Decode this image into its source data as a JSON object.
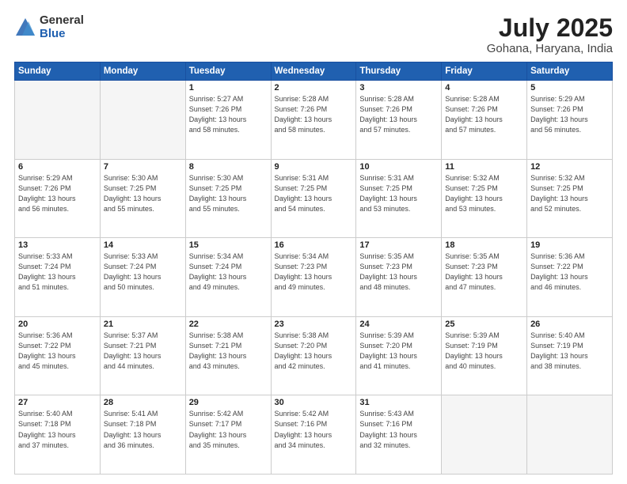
{
  "header": {
    "logo_general": "General",
    "logo_blue": "Blue",
    "month_year": "July 2025",
    "location": "Gohana, Haryana, India"
  },
  "weekdays": [
    "Sunday",
    "Monday",
    "Tuesday",
    "Wednesday",
    "Thursday",
    "Friday",
    "Saturday"
  ],
  "weeks": [
    [
      {
        "day": "",
        "info": ""
      },
      {
        "day": "",
        "info": ""
      },
      {
        "day": "1",
        "info": "Sunrise: 5:27 AM\nSunset: 7:26 PM\nDaylight: 13 hours\nand 58 minutes."
      },
      {
        "day": "2",
        "info": "Sunrise: 5:28 AM\nSunset: 7:26 PM\nDaylight: 13 hours\nand 58 minutes."
      },
      {
        "day": "3",
        "info": "Sunrise: 5:28 AM\nSunset: 7:26 PM\nDaylight: 13 hours\nand 57 minutes."
      },
      {
        "day": "4",
        "info": "Sunrise: 5:28 AM\nSunset: 7:26 PM\nDaylight: 13 hours\nand 57 minutes."
      },
      {
        "day": "5",
        "info": "Sunrise: 5:29 AM\nSunset: 7:26 PM\nDaylight: 13 hours\nand 56 minutes."
      }
    ],
    [
      {
        "day": "6",
        "info": "Sunrise: 5:29 AM\nSunset: 7:26 PM\nDaylight: 13 hours\nand 56 minutes."
      },
      {
        "day": "7",
        "info": "Sunrise: 5:30 AM\nSunset: 7:25 PM\nDaylight: 13 hours\nand 55 minutes."
      },
      {
        "day": "8",
        "info": "Sunrise: 5:30 AM\nSunset: 7:25 PM\nDaylight: 13 hours\nand 55 minutes."
      },
      {
        "day": "9",
        "info": "Sunrise: 5:31 AM\nSunset: 7:25 PM\nDaylight: 13 hours\nand 54 minutes."
      },
      {
        "day": "10",
        "info": "Sunrise: 5:31 AM\nSunset: 7:25 PM\nDaylight: 13 hours\nand 53 minutes."
      },
      {
        "day": "11",
        "info": "Sunrise: 5:32 AM\nSunset: 7:25 PM\nDaylight: 13 hours\nand 53 minutes."
      },
      {
        "day": "12",
        "info": "Sunrise: 5:32 AM\nSunset: 7:25 PM\nDaylight: 13 hours\nand 52 minutes."
      }
    ],
    [
      {
        "day": "13",
        "info": "Sunrise: 5:33 AM\nSunset: 7:24 PM\nDaylight: 13 hours\nand 51 minutes."
      },
      {
        "day": "14",
        "info": "Sunrise: 5:33 AM\nSunset: 7:24 PM\nDaylight: 13 hours\nand 50 minutes."
      },
      {
        "day": "15",
        "info": "Sunrise: 5:34 AM\nSunset: 7:24 PM\nDaylight: 13 hours\nand 49 minutes."
      },
      {
        "day": "16",
        "info": "Sunrise: 5:34 AM\nSunset: 7:23 PM\nDaylight: 13 hours\nand 49 minutes."
      },
      {
        "day": "17",
        "info": "Sunrise: 5:35 AM\nSunset: 7:23 PM\nDaylight: 13 hours\nand 48 minutes."
      },
      {
        "day": "18",
        "info": "Sunrise: 5:35 AM\nSunset: 7:23 PM\nDaylight: 13 hours\nand 47 minutes."
      },
      {
        "day": "19",
        "info": "Sunrise: 5:36 AM\nSunset: 7:22 PM\nDaylight: 13 hours\nand 46 minutes."
      }
    ],
    [
      {
        "day": "20",
        "info": "Sunrise: 5:36 AM\nSunset: 7:22 PM\nDaylight: 13 hours\nand 45 minutes."
      },
      {
        "day": "21",
        "info": "Sunrise: 5:37 AM\nSunset: 7:21 PM\nDaylight: 13 hours\nand 44 minutes."
      },
      {
        "day": "22",
        "info": "Sunrise: 5:38 AM\nSunset: 7:21 PM\nDaylight: 13 hours\nand 43 minutes."
      },
      {
        "day": "23",
        "info": "Sunrise: 5:38 AM\nSunset: 7:20 PM\nDaylight: 13 hours\nand 42 minutes."
      },
      {
        "day": "24",
        "info": "Sunrise: 5:39 AM\nSunset: 7:20 PM\nDaylight: 13 hours\nand 41 minutes."
      },
      {
        "day": "25",
        "info": "Sunrise: 5:39 AM\nSunset: 7:19 PM\nDaylight: 13 hours\nand 40 minutes."
      },
      {
        "day": "26",
        "info": "Sunrise: 5:40 AM\nSunset: 7:19 PM\nDaylight: 13 hours\nand 38 minutes."
      }
    ],
    [
      {
        "day": "27",
        "info": "Sunrise: 5:40 AM\nSunset: 7:18 PM\nDaylight: 13 hours\nand 37 minutes."
      },
      {
        "day": "28",
        "info": "Sunrise: 5:41 AM\nSunset: 7:18 PM\nDaylight: 13 hours\nand 36 minutes."
      },
      {
        "day": "29",
        "info": "Sunrise: 5:42 AM\nSunset: 7:17 PM\nDaylight: 13 hours\nand 35 minutes."
      },
      {
        "day": "30",
        "info": "Sunrise: 5:42 AM\nSunset: 7:16 PM\nDaylight: 13 hours\nand 34 minutes."
      },
      {
        "day": "31",
        "info": "Sunrise: 5:43 AM\nSunset: 7:16 PM\nDaylight: 13 hours\nand 32 minutes."
      },
      {
        "day": "",
        "info": ""
      },
      {
        "day": "",
        "info": ""
      }
    ]
  ]
}
